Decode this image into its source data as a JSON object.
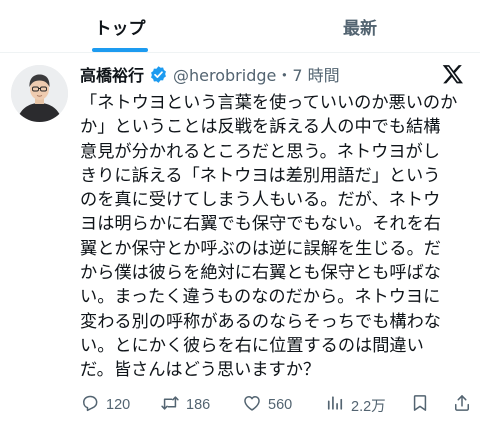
{
  "tabs": [
    {
      "label": "トップ",
      "active": true
    },
    {
      "label": "最新",
      "active": false
    }
  ],
  "post": {
    "display_name": "高橋裕行",
    "handle_time": "@herobridge・7 時間",
    "text_lines": [
      "「ネトウヨという言葉を使っていいのか悪いのか",
      "か」ということは反戦を訴える人の中でも結構",
      "意見が分かれるところだと思う。ネトウヨがし",
      "きりに訴える「ネトウヨは差別用語だ」という",
      "のを真に受けてしまう人もいる。だが、ネトウ",
      "ヨは明らかに右翼でも保守でもない。それを右",
      "翼とか保守とか呼ぶのは逆に誤解を生じる。だ",
      "から僕は彼らを絶対に右翼とも保守とも呼ばな",
      "い。まったく違うものなのだから。ネトウヨに",
      "変わる別の呼称があるのならそっちでも構わな",
      "い。とにかく彼らを右に位置するのは間違い",
      "だ。皆さんはどう思いますか？"
    ],
    "metrics": {
      "replies": "120",
      "reposts": "186",
      "likes": "560",
      "views": "2.2万"
    }
  },
  "colors": {
    "accent": "#1d9bf0",
    "text": "#0f1419",
    "secondary": "#536471",
    "divider": "#eff3f4"
  },
  "icons": [
    "verified-badge-icon",
    "x-logo-icon",
    "reply-icon",
    "repost-icon",
    "like-icon",
    "views-icon",
    "bookmark-icon",
    "share-icon"
  ]
}
